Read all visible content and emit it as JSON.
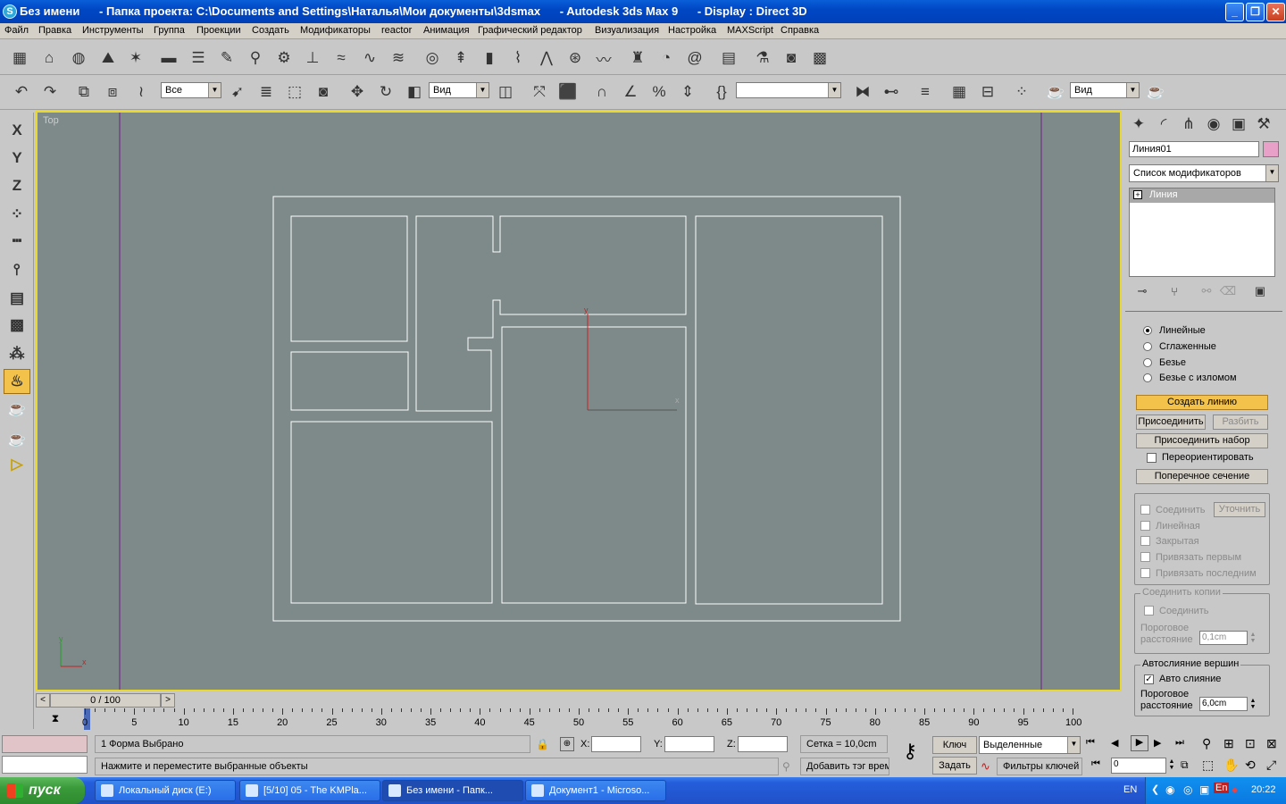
{
  "window": {
    "title": "Без имени      - Папка проекта: C:\\Documents and Settings\\Наталья\\Мои документы\\3dsmax      - Autodesk 3ds Max 9      - Display : Direct 3D",
    "minimize": "_",
    "maximize": "❐",
    "close": "✕"
  },
  "menu": [
    "Файл",
    "Правка",
    "Инструменты",
    "Группа",
    "Проекции",
    "Создать",
    "Модификаторы",
    "reactor",
    "Анимация",
    "Графический редактор",
    "Визуализация",
    "Настройка",
    "MAXScript",
    "Справка"
  ],
  "toolbar2": {
    "selection_filter": "Все",
    "ref_coord": "Вид",
    "named_sel": "",
    "render_type": "Вид"
  },
  "left_axis": [
    "X",
    "Y",
    "Z"
  ],
  "viewport": {
    "label": "Top",
    "gizmo_x": "x",
    "gizmo_y": "y",
    "axis_x": "x",
    "axis_y": "y"
  },
  "scroll": {
    "frame": "0 / 100",
    "prev": "<",
    "next": ">"
  },
  "timeline": {
    "ticks": [
      "0",
      "5",
      "10",
      "15",
      "20",
      "25",
      "30",
      "35",
      "40",
      "45",
      "50",
      "55",
      "60",
      "65",
      "70",
      "75",
      "80",
      "85",
      "90",
      "95",
      "100"
    ]
  },
  "command_panel": {
    "object_name": "Линия01",
    "modifier_list": "Список модификаторов",
    "stack_item": "Линия",
    "interp": [
      "Линейные",
      "Сглаженные",
      "Безье",
      "Безье с изломом"
    ],
    "interp_selected": 0,
    "create_line": "Создать линию",
    "attach": "Присоединить",
    "detach": "Разбить",
    "attach_mult": "Присоединить набор",
    "reorient": "Переориентировать",
    "cross_section": "Поперечное сечение",
    "connect": "Соединить",
    "refine": "Уточнить",
    "linear": "Линейная",
    "closed": "Закрытая",
    "bind_first": "Привязать первым",
    "bind_last": "Привязать последним",
    "connect_copy_title": "Соединить копии",
    "connect_copy": "Соединить",
    "threshold1": "Пороговое",
    "threshold2": "расстояние",
    "threshold_val1": "0,1cm",
    "autoweld_title": "Автослияние вершин",
    "autoweld": "Авто слияние",
    "threshold_val2": "6,0cm"
  },
  "status": {
    "selected": "1 Форма Выбрано",
    "prompt": "Нажмите и переместите выбранные объекты",
    "x_label": "X:",
    "y_label": "Y:",
    "z_label": "Z:",
    "x": "",
    "y": "",
    "z": "",
    "grid": "Сетка = 10,0cm",
    "add_tag": "Добавить тэг врем",
    "key": "Ключ",
    "set": "Задать",
    "key_mode": "Выделенные",
    "key_filters": "Фильтры ключей",
    "frame": "0"
  },
  "taskbar": {
    "start": "пуск",
    "tasks": [
      "Локальный диск (E:)",
      "[5/10] 05 - The KMPla...",
      "Без имени      - Папк...",
      "Документ1 - Microso..."
    ],
    "active": 2,
    "lang": "EN",
    "tray_lang": "En",
    "time": "20:22"
  },
  "colors": {
    "viewport_bg": "#7e8a8a",
    "viewport_border": "#e8d830",
    "lines": "#ffffff",
    "object_color": "#e8a0c8",
    "highlight": "#f2c24a"
  }
}
